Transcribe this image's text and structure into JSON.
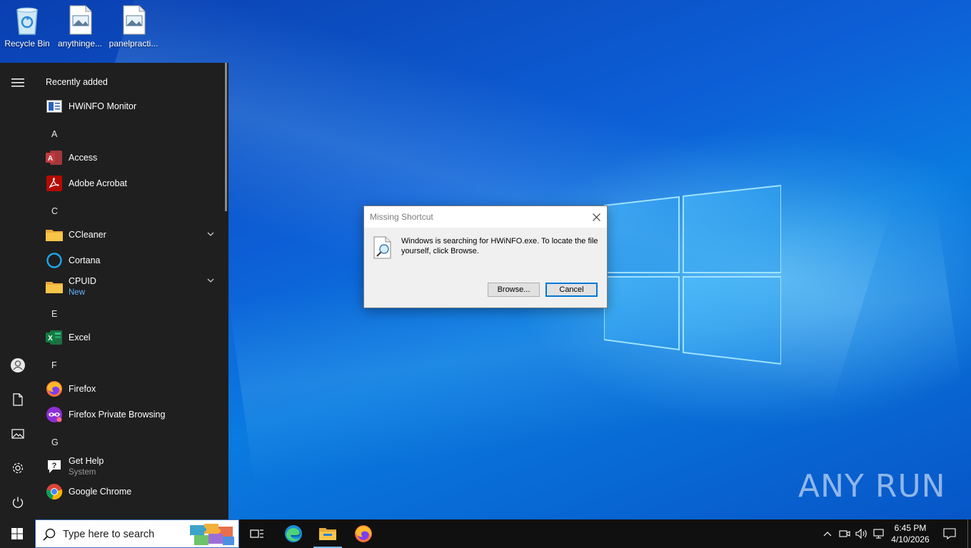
{
  "desktop": {
    "icons": [
      {
        "label": "Recycle Bin",
        "icon": "recycle-bin-icon"
      },
      {
        "label": "anythinge...",
        "icon": "image-file-icon"
      },
      {
        "label": "panelpracti...",
        "icon": "image-file-icon"
      }
    ],
    "watermark": "ANY RUN"
  },
  "start_menu": {
    "header": "Recently added",
    "items": [
      {
        "label": "HWiNFO Monitor",
        "icon": "hwinfo-icon"
      },
      {
        "letter": "A"
      },
      {
        "label": "Access",
        "icon": "access-icon"
      },
      {
        "label": "Adobe Acrobat",
        "icon": "acrobat-icon"
      },
      {
        "letter": "C"
      },
      {
        "label": "CCleaner",
        "icon": "folder-icon",
        "expandable": true
      },
      {
        "label": "Cortana",
        "icon": "cortana-icon"
      },
      {
        "label": "CPUID",
        "sub": "New",
        "icon": "folder-icon",
        "expandable": true
      },
      {
        "letter": "E"
      },
      {
        "label": "Excel",
        "icon": "excel-icon"
      },
      {
        "letter": "F"
      },
      {
        "label": "Firefox",
        "icon": "firefox-icon"
      },
      {
        "label": "Firefox Private Browsing",
        "icon": "firefox-private-icon"
      },
      {
        "letter": "G"
      },
      {
        "label": "Get Help",
        "sub": "System",
        "icon": "get-help-icon"
      },
      {
        "label": "Google Chrome",
        "icon": "chrome-icon"
      }
    ],
    "rail": [
      "menu-icon",
      "user-icon",
      "documents-icon",
      "pictures-icon",
      "settings-icon",
      "power-icon"
    ]
  },
  "dialog": {
    "title": "Missing Shortcut",
    "message": "Windows is searching for HWiNFO.exe. To locate the file yourself, click Browse.",
    "browse_label": "Browse...",
    "cancel_label": "Cancel"
  },
  "taskbar": {
    "search_placeholder": "Type here to search",
    "apps": [
      "task-view-icon",
      "edge-icon",
      "file-explorer-icon",
      "firefox-icon"
    ],
    "time": "6:45 PM",
    "date": "4/10/2026"
  },
  "colors": {
    "accent": "#0078d7",
    "start_bg": "#1f1f1f",
    "taskbar_bg": "#101010"
  }
}
